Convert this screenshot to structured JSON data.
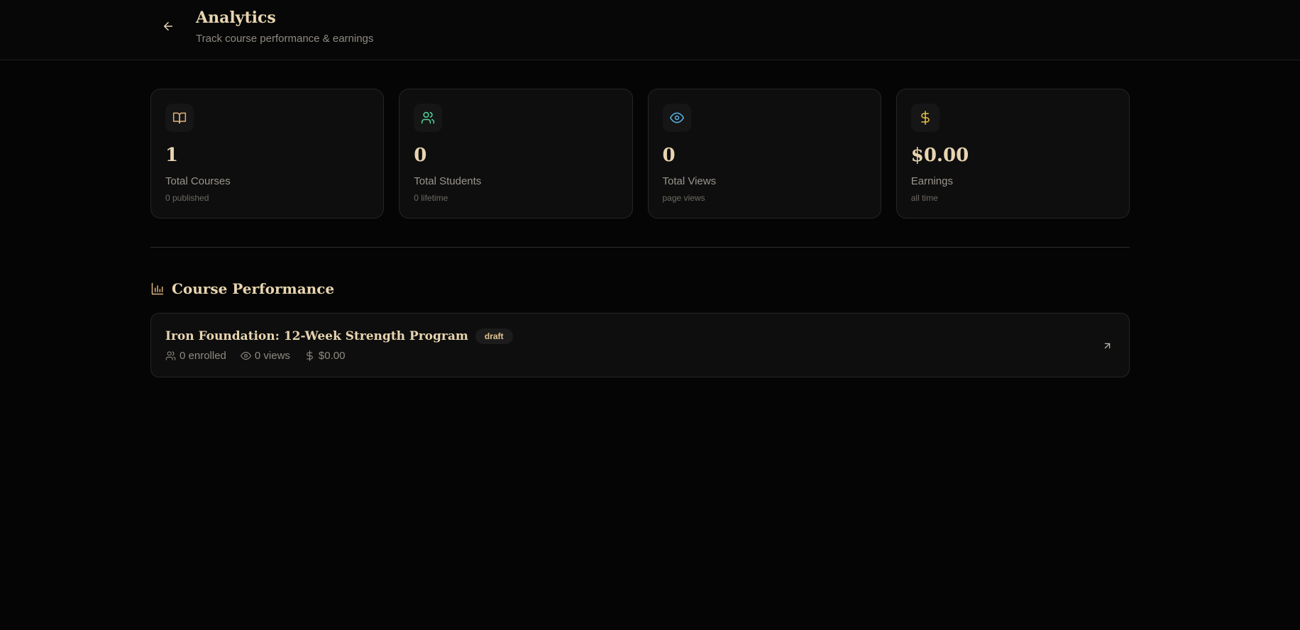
{
  "header": {
    "title": "Analytics",
    "subtitle": "Track course performance & earnings"
  },
  "stats": [
    {
      "icon": "book-icon",
      "value": "1",
      "label": "Total Courses",
      "sub": "0 published",
      "color": "#e0b27a"
    },
    {
      "icon": "users-icon",
      "value": "0",
      "label": "Total Students",
      "sub": "0 lifetime",
      "color": "#4fd69c"
    },
    {
      "icon": "eye-icon",
      "value": "0",
      "label": "Total Views",
      "sub": "page views",
      "color": "#5ab4e8"
    },
    {
      "icon": "dollar-icon",
      "value": "$0.00",
      "label": "Earnings",
      "sub": "all time",
      "color": "#e8c24a"
    }
  ],
  "performance": {
    "title": "Course Performance",
    "courses": [
      {
        "title": "Iron Foundation: 12-Week Strength Program",
        "status": "draft",
        "enrolled": "0 enrolled",
        "views": "0 views",
        "earnings": "$0.00"
      }
    ]
  },
  "colors": {
    "background": "#050505",
    "card": "#0e0e0e",
    "accent": "#e8d5b0"
  }
}
